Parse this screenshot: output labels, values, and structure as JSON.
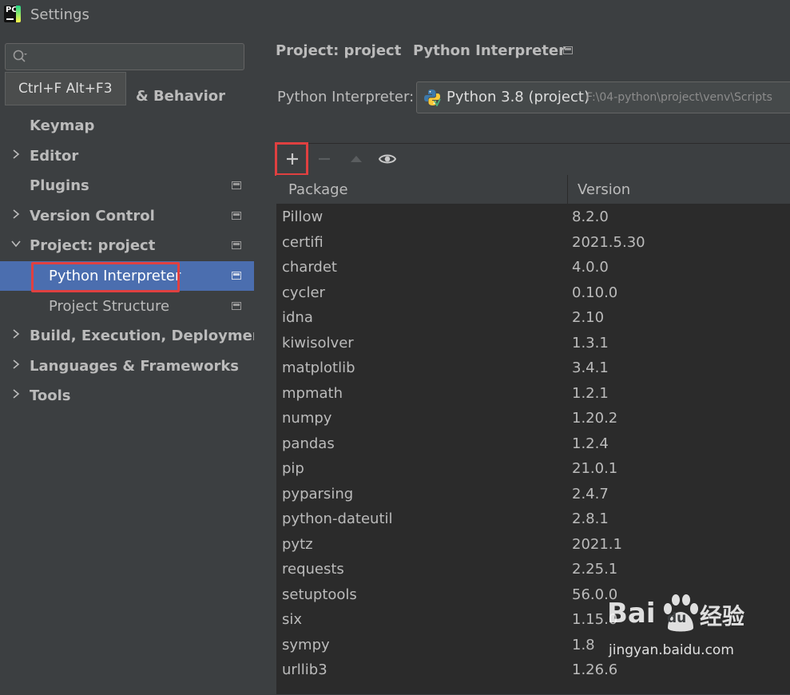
{
  "window": {
    "title": "Settings"
  },
  "search": {
    "placeholder": "",
    "tooltip": "Ctrl+F Alt+F3"
  },
  "sidebar": {
    "partial_label": "& Behavior",
    "items": [
      {
        "label": "Keymap",
        "expandable": false,
        "has_icon": false
      },
      {
        "label": "Editor",
        "expandable": true,
        "has_icon": false
      },
      {
        "label": "Plugins",
        "expandable": false,
        "has_icon": true
      },
      {
        "label": "Version Control",
        "expandable": true,
        "has_icon": true
      },
      {
        "label": "Project: project",
        "expandable": true,
        "expanded": true,
        "has_icon": true
      },
      {
        "label": "Python Interpreter",
        "child": true,
        "selected": true,
        "has_icon": true
      },
      {
        "label": "Project Structure",
        "child": true,
        "has_icon": true
      },
      {
        "label": "Build, Execution, Deployment",
        "expandable": true,
        "has_icon": false
      },
      {
        "label": "Languages & Frameworks",
        "expandable": true,
        "has_icon": false
      },
      {
        "label": "Tools",
        "expandable": true,
        "has_icon": false
      }
    ]
  },
  "breadcrumb": {
    "parent": "Project: project",
    "separator": "›",
    "current": "Python Interpreter"
  },
  "interpreter": {
    "label": "Python Interpreter:",
    "selected_name": "Python 3.8 (project)",
    "selected_path": "F:\\04-python\\project\\venv\\Scripts"
  },
  "toolbar": {
    "buttons": [
      "plus-icon",
      "minus-icon",
      "upgrade-icon",
      "eye-icon"
    ]
  },
  "table": {
    "columns": [
      "Package",
      "Version"
    ],
    "rows": [
      [
        "Pillow",
        "8.2.0"
      ],
      [
        "certifi",
        "2021.5.30"
      ],
      [
        "chardet",
        "4.0.0"
      ],
      [
        "cycler",
        "0.10.0"
      ],
      [
        "idna",
        "2.10"
      ],
      [
        "kiwisolver",
        "1.3.1"
      ],
      [
        "matplotlib",
        "3.4.1"
      ],
      [
        "mpmath",
        "1.2.1"
      ],
      [
        "numpy",
        "1.20.2"
      ],
      [
        "pandas",
        "1.2.4"
      ],
      [
        "pip",
        "21.0.1"
      ],
      [
        "pyparsing",
        "2.4.7"
      ],
      [
        "python-dateutil",
        "2.8.1"
      ],
      [
        "pytz",
        "2021.1"
      ],
      [
        "requests",
        "2.25.1"
      ],
      [
        "setuptools",
        "56.0.0"
      ],
      [
        "six",
        "1.15.0"
      ],
      [
        "sympy",
        "1.8"
      ],
      [
        "urllib3",
        "1.26.6"
      ]
    ]
  },
  "watermark": {
    "brand": "Bai",
    "brand2": "du",
    "cn": "经验",
    "url": "jingyan.baidu.com"
  },
  "colors": {
    "selection": "#4b6eaf",
    "highlight": "#e04040",
    "background": "#3c3f41",
    "table_bg": "#2b2b2b"
  }
}
